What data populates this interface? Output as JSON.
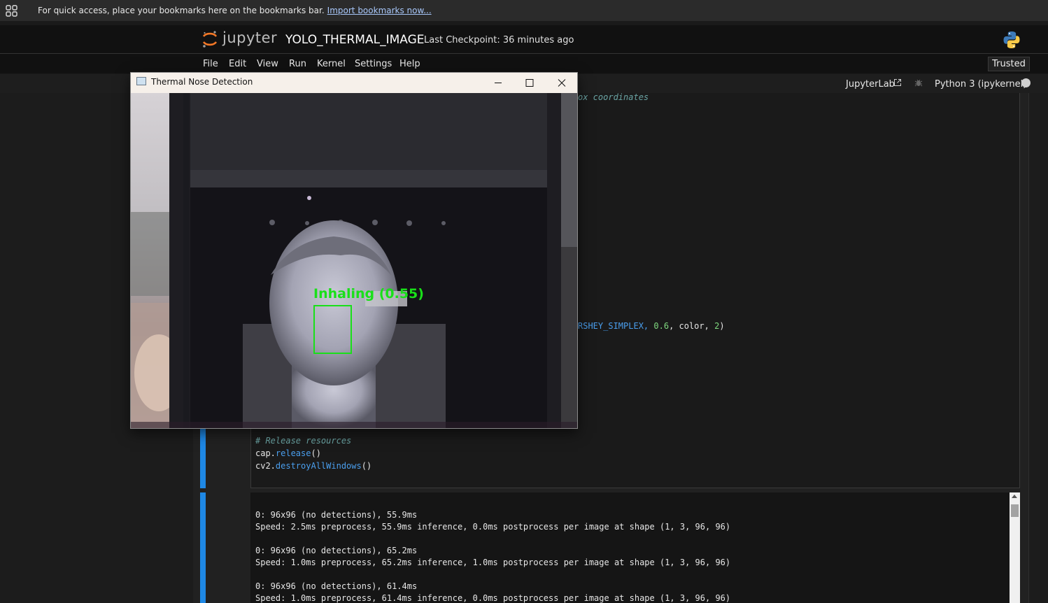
{
  "bookmarks_bar": {
    "message": "For quick access, place your bookmarks here on the bookmarks bar.",
    "import_link": "Import bookmarks now..."
  },
  "header": {
    "logo_text": "jupyter",
    "notebook_title": "YOLO_THERMAL_IMAGE",
    "checkpoint": "Last Checkpoint: 36 minutes ago"
  },
  "menu": {
    "items": [
      "File",
      "Edit",
      "View",
      "Run",
      "Kernel",
      "Settings",
      "Help"
    ],
    "trusted": "Trusted"
  },
  "toolbar": {
    "jupyterlab_link": "JupyterLab",
    "kernel": "Python 3 (ipykernel)"
  },
  "code_cell": {
    "visible_comment_fragment": "ox coordinates",
    "visible_code_fragment": {
      "prefix": "RSHEY_SIMPLEX, ",
      "num1": "0.6",
      "mid": ", color, ",
      "num2": "2",
      "suffix": ")"
    },
    "release_comment": "# Release resources",
    "line_cap_obj": "cap.",
    "line_cap_fn": "release",
    "line_cap_end": "()",
    "line_cv2_obj": "cv2.",
    "line_cv2_fn": "destroyAllWindows",
    "line_cv2_end": "()"
  },
  "output": {
    "lines": [
      "0: 96x96 (no detections), 55.9ms",
      "Speed: 2.5ms preprocess, 55.9ms inference, 0.0ms postprocess per image at shape (1, 3, 96, 96)",
      "",
      "0: 96x96 (no detections), 65.2ms",
      "Speed: 1.0ms preprocess, 65.2ms inference, 1.0ms postprocess per image at shape (1, 3, 96, 96)",
      "",
      "0: 96x96 (no detections), 61.4ms",
      "Speed: 1.0ms preprocess, 61.4ms inference, 0.0ms postprocess per image at shape (1, 3, 96, 96)"
    ]
  },
  "popup": {
    "title": "Thermal Nose Detection",
    "detection_label": "Inhaling (0.55)"
  },
  "colors": {
    "accent_blue": "#1e88e5",
    "detection_green": "#19e019",
    "jupyter_orange": "#f37726"
  }
}
